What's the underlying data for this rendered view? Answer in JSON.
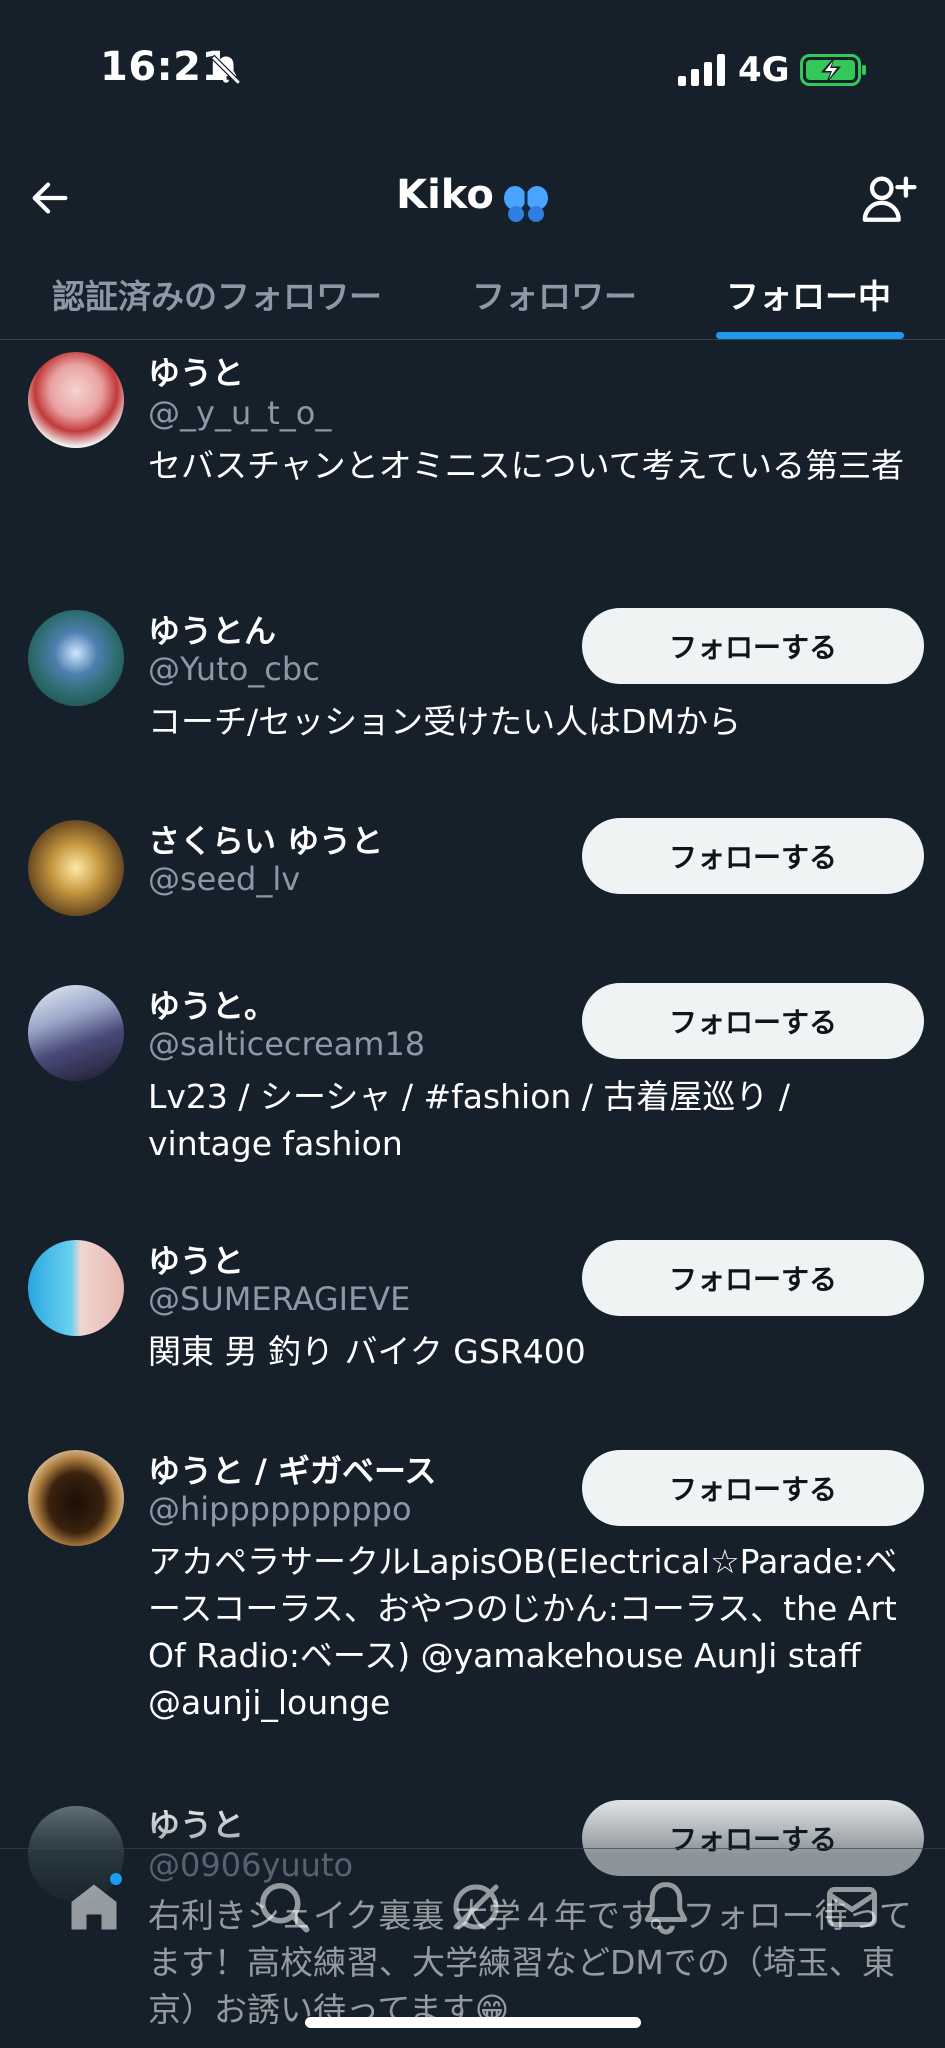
{
  "status_bar": {
    "time": "16:21",
    "network": "4G"
  },
  "header": {
    "title": "Kiko"
  },
  "tabs": [
    {
      "label": "認証済みのフォロワー"
    },
    {
      "label": "フォロワー"
    },
    {
      "label": "フォロー中"
    }
  ],
  "follow_label": "フォローする",
  "users": [
    {
      "name": "ゆうと",
      "handle": "@_y_u_t_o_",
      "bio": "セバスチャンとオミニスについて考えている第三者"
    },
    {
      "name": "ゆうとん",
      "handle": "@Yuto_cbc",
      "bio": "コーチ/セッション受けたい人はDMから"
    },
    {
      "name": "さくらい ゆうと",
      "handle": "@seed_lv",
      "bio": ""
    },
    {
      "name": "ゆうと。",
      "handle": "@salticecream18",
      "bio": "Lv23 / シーシャ / #fashion / 古着屋巡り / vintage fashion"
    },
    {
      "name": "ゆうと",
      "handle": "@SUMERAGIEVE",
      "bio": "関東 男 釣り バイク GSR400"
    },
    {
      "name": "ゆうと / ギガベース",
      "handle": "@hipppppppppo",
      "bio": "アカペラサークルLapisOB(Electrical☆Parade:ベースコーラス、おやつのじかん:コーラス、the Art Of Radio:ベース) @yamakehouse AunJi staff @aunji_lounge"
    },
    {
      "name": "ゆうと",
      "handle": "@0906yuuto",
      "bio": "右利きシェイク裏裏 大学４年です。フォロー待ってます！高校練習、大学練習などDMでの（埼玉、東京）お誘い待ってます😁"
    }
  ],
  "colors": {
    "background": "#15202b",
    "accent": "#1d9bf0",
    "secondary_text": "#8b98a5",
    "button_bg": "#eff3f4"
  },
  "icons": {
    "back": "arrow-left-icon",
    "add_user": "person-plus-icon",
    "bell": "bell-slash-icon",
    "nav": [
      "home-icon",
      "search-icon",
      "spaces-icon",
      "notifications-icon",
      "messages-icon"
    ]
  }
}
